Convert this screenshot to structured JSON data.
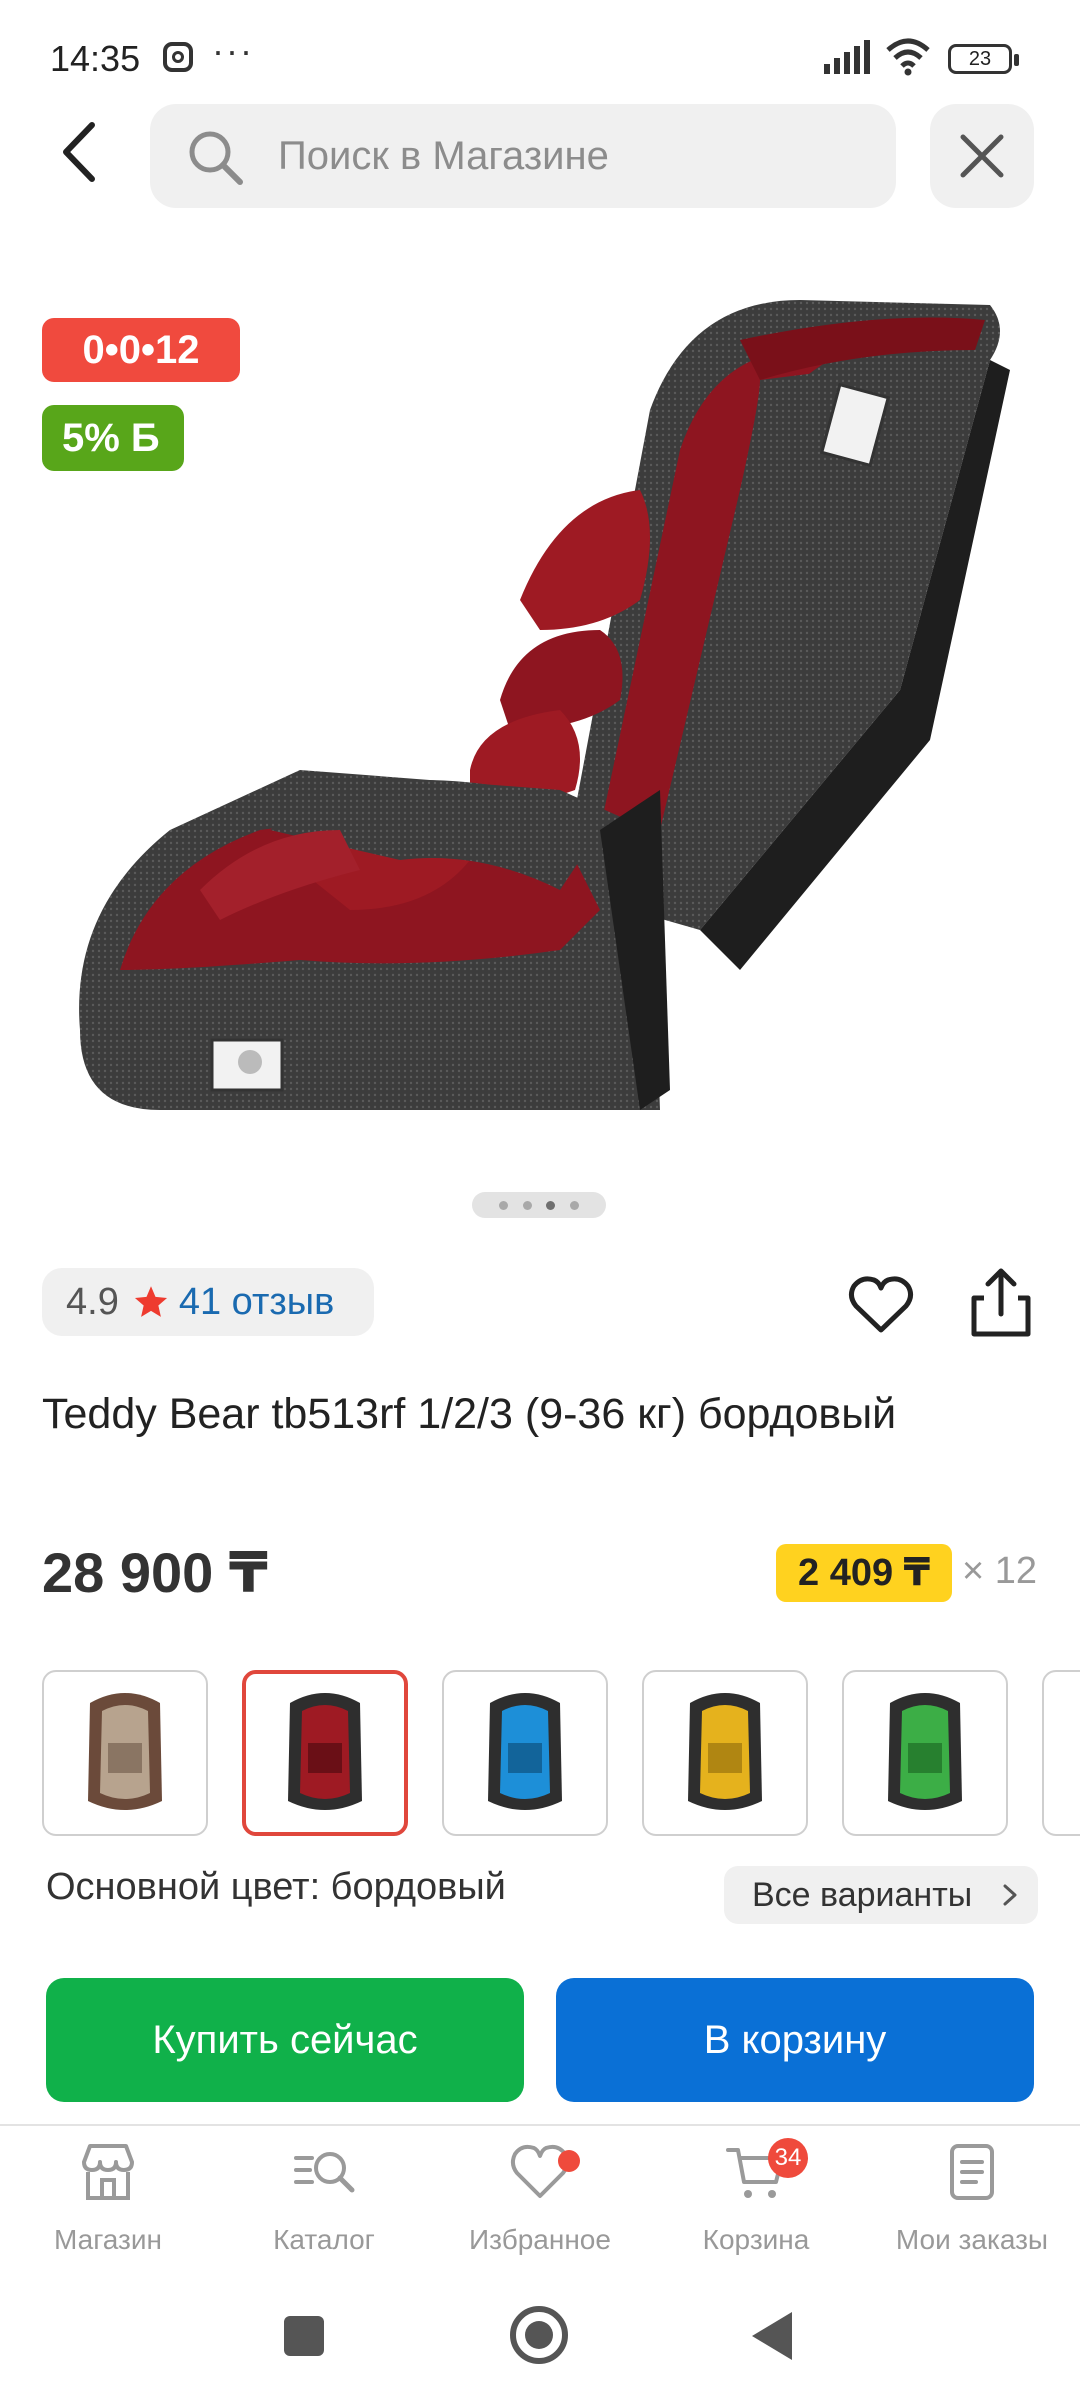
{
  "status_bar": {
    "time": "14:35",
    "more_indicator": "···",
    "battery": "23",
    "icons": [
      "instagram-icon",
      "signal-icon",
      "wifi-icon",
      "battery-icon"
    ]
  },
  "search": {
    "placeholder": "Поиск в Магазине"
  },
  "product": {
    "image_pager": {
      "count": 4,
      "active_index": 2
    },
    "badges": {
      "installment": "0•0•12",
      "bonus": "5% Б"
    },
    "rating": "4.9",
    "reviews": "41 отзыв",
    "title": "Teddy Bear tb513rf 1/2/3 (9-36 кг) бордовый",
    "price": "28 900 ₸",
    "installment_price": "2 409 ₸",
    "installment_months": "× 12",
    "color_label": "Основной цвет: бордовый",
    "all_variants": "Все варианты",
    "variants": [
      {
        "color": "beige",
        "hex": "#b7a38e",
        "frame": "#6b4a3a",
        "selected": false
      },
      {
        "color": "bordeaux",
        "hex": "#9e1a23",
        "frame": "#2e2e2e",
        "selected": true
      },
      {
        "color": "blue",
        "hex": "#1d8fd8",
        "frame": "#2e2e2e",
        "selected": false
      },
      {
        "color": "yellow",
        "hex": "#e5b21d",
        "frame": "#2e2e2e",
        "selected": false
      },
      {
        "color": "green",
        "hex": "#3cae46",
        "frame": "#2e2e2e",
        "selected": false
      }
    ]
  },
  "actions": {
    "buy_now": "Купить сейчас",
    "add_to_cart": "В корзину"
  },
  "bottom_nav": {
    "items": [
      {
        "label": "Магазин",
        "icon": "store-icon"
      },
      {
        "label": "Каталог",
        "icon": "catalog-search-icon"
      },
      {
        "label": "Избранное",
        "icon": "heart-icon"
      },
      {
        "label": "Корзина",
        "icon": "cart-icon",
        "badge": "34"
      },
      {
        "label": "Мои заказы",
        "icon": "orders-icon"
      }
    ]
  },
  "colors": {
    "accent_red": "#f04a3e",
    "bonus_green": "#58a61a",
    "buy_green": "#10b14a",
    "cart_blue": "#0a70d6",
    "installment_yellow": "#ffd21f",
    "link_blue": "#1a6ab0"
  }
}
